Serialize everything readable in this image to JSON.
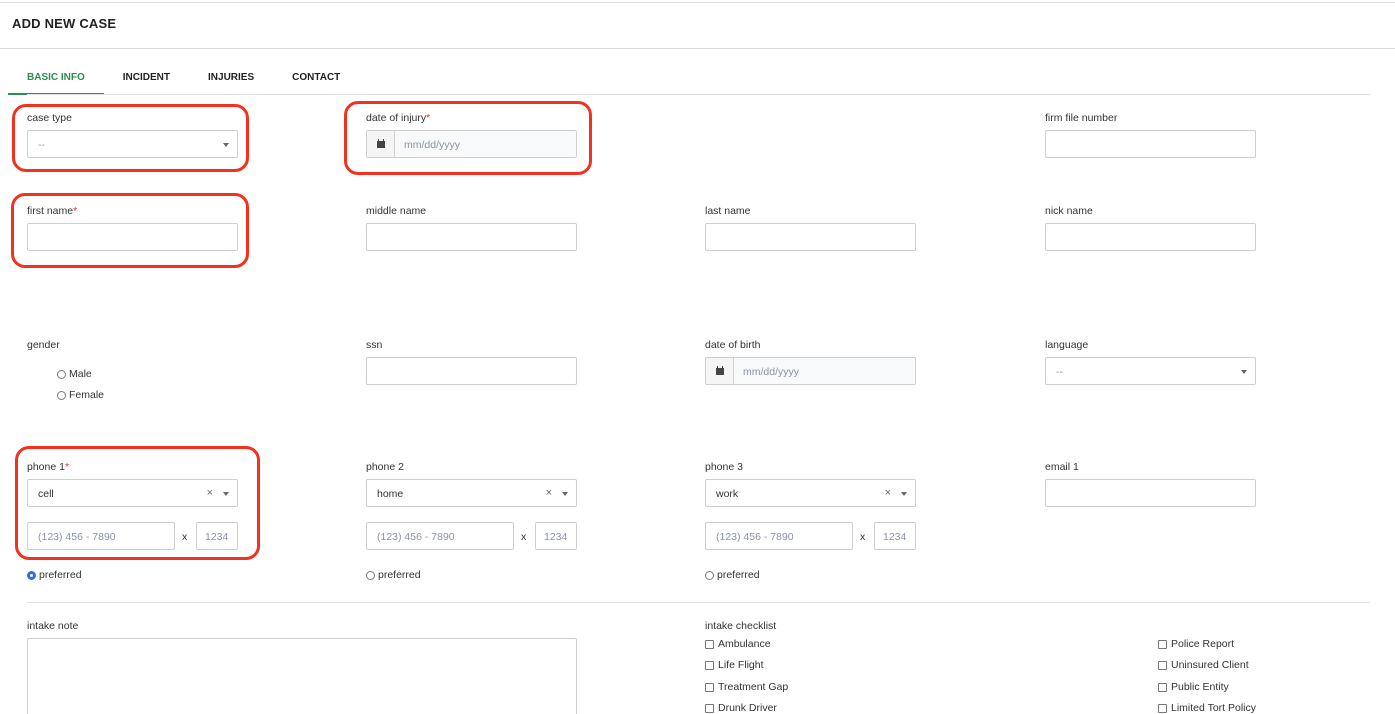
{
  "header": {
    "title": "ADD NEW CASE"
  },
  "tabs": [
    {
      "label": "BASIC INFO",
      "active": true
    },
    {
      "label": "INCIDENT",
      "active": false
    },
    {
      "label": "INJURIES",
      "active": false
    },
    {
      "label": "CONTACT",
      "active": false
    }
  ],
  "form": {
    "case_type": {
      "label": "case type",
      "value": "--"
    },
    "date_of_injury": {
      "label": "date of injury",
      "required_mark": "*",
      "placeholder": "mm/dd/yyyy"
    },
    "firm_file_number": {
      "label": "firm file number",
      "value": ""
    },
    "first_name": {
      "label": "first name",
      "required_mark": "*",
      "value": ""
    },
    "middle_name": {
      "label": "middle name",
      "value": ""
    },
    "last_name": {
      "label": "last name",
      "value": ""
    },
    "nick_name": {
      "label": "nick name",
      "value": ""
    },
    "gender": {
      "label": "gender",
      "options": [
        "Male",
        "Female"
      ],
      "selected": null
    },
    "ssn": {
      "label": "ssn",
      "value": ""
    },
    "date_of_birth": {
      "label": "date of birth",
      "placeholder": "mm/dd/yyyy"
    },
    "language": {
      "label": "language",
      "value": "--"
    },
    "phone1": {
      "label": "phone 1",
      "required_mark": "*",
      "type": "cell",
      "number_placeholder": "(123) 456 - 7890",
      "ext_placeholder": "1234",
      "preferred": true
    },
    "phone2": {
      "label": "phone 2",
      "type": "home",
      "number_placeholder": "(123) 456 - 7890",
      "ext_placeholder": "1234",
      "preferred": false
    },
    "phone3": {
      "label": "phone 3",
      "type": "work",
      "number_placeholder": "(123) 456 - 7890",
      "ext_placeholder": "1234",
      "preferred": false
    },
    "email1": {
      "label": "email 1",
      "value": ""
    },
    "ext_separator": "x",
    "clear_glyph": "×",
    "preferred_label": "preferred",
    "intake_note": {
      "label": "intake note",
      "value": ""
    },
    "intake_checklist": {
      "label": "intake checklist",
      "left": [
        "Ambulance",
        "Life Flight",
        "Treatment Gap",
        "Drunk Driver"
      ],
      "right": [
        "Police Report",
        "Uninsured Client",
        "Public Entity",
        "Limited Tort Policy"
      ]
    }
  },
  "colors": {
    "accent": "#2a8f4f",
    "required": "#e0352b",
    "highlight": "#f2321f",
    "radio_on": "#2f6fde"
  }
}
